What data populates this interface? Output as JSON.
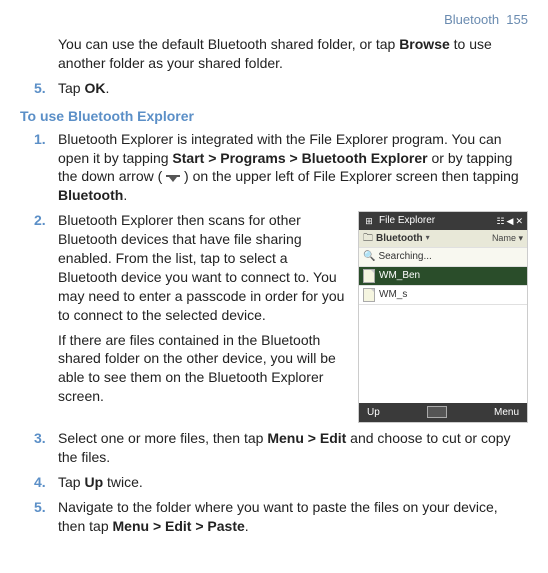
{
  "header": {
    "section": "Bluetooth",
    "page": "155"
  },
  "intro_para": {
    "pre": "You can use the default Bluetooth shared folder, or tap ",
    "bold": "Browse",
    "post": " to use another folder as your shared folder."
  },
  "intro_step5": {
    "num": "5.",
    "pre": "Tap ",
    "bold": "OK",
    "post": "."
  },
  "section_title": "To use Bluetooth Explorer",
  "steps": {
    "s1": {
      "num": "1.",
      "t1": "Bluetooth Explorer is integrated with the File Explorer program. You can open it by tapping ",
      "b1": "Start > Programs > Bluetooth Explorer",
      "t2": " or by tapping the down arrow ( ",
      "t3": " ) on the upper left of File Explorer screen then tapping ",
      "b2": "Bluetooth",
      "t4": "."
    },
    "s2": {
      "num": "2.",
      "p1": "Bluetooth Explorer then scans for other Bluetooth devices that have file sharing enabled. From the list, tap to select a Bluetooth device you want to connect to. You may need to enter a passcode in order for you to connect to the selected device.",
      "p2": "If there are files contained in the Bluetooth shared folder on the other device, you will be able to see them on the Bluetooth Explorer screen."
    },
    "s3": {
      "num": "3.",
      "t1": "Select one or more files, then tap ",
      "b1": "Menu > Edit",
      "t2": " and choose to cut or copy the files."
    },
    "s4": {
      "num": "4.",
      "t1": "Tap ",
      "b1": "Up",
      "t2": " twice."
    },
    "s5": {
      "num": "5.",
      "t1": "Navigate to the folder where you want to paste the files on your device, then tap ",
      "b1": "Menu > Edit > Paste",
      "t2": "."
    }
  },
  "figure": {
    "title": "File Explorer",
    "breadcrumb": "Bluetooth",
    "sort": "Name",
    "searching": "Searching...",
    "item_selected": "WM_Ben",
    "item2": "WM_s",
    "btn_up": "Up",
    "btn_menu": "Menu"
  }
}
